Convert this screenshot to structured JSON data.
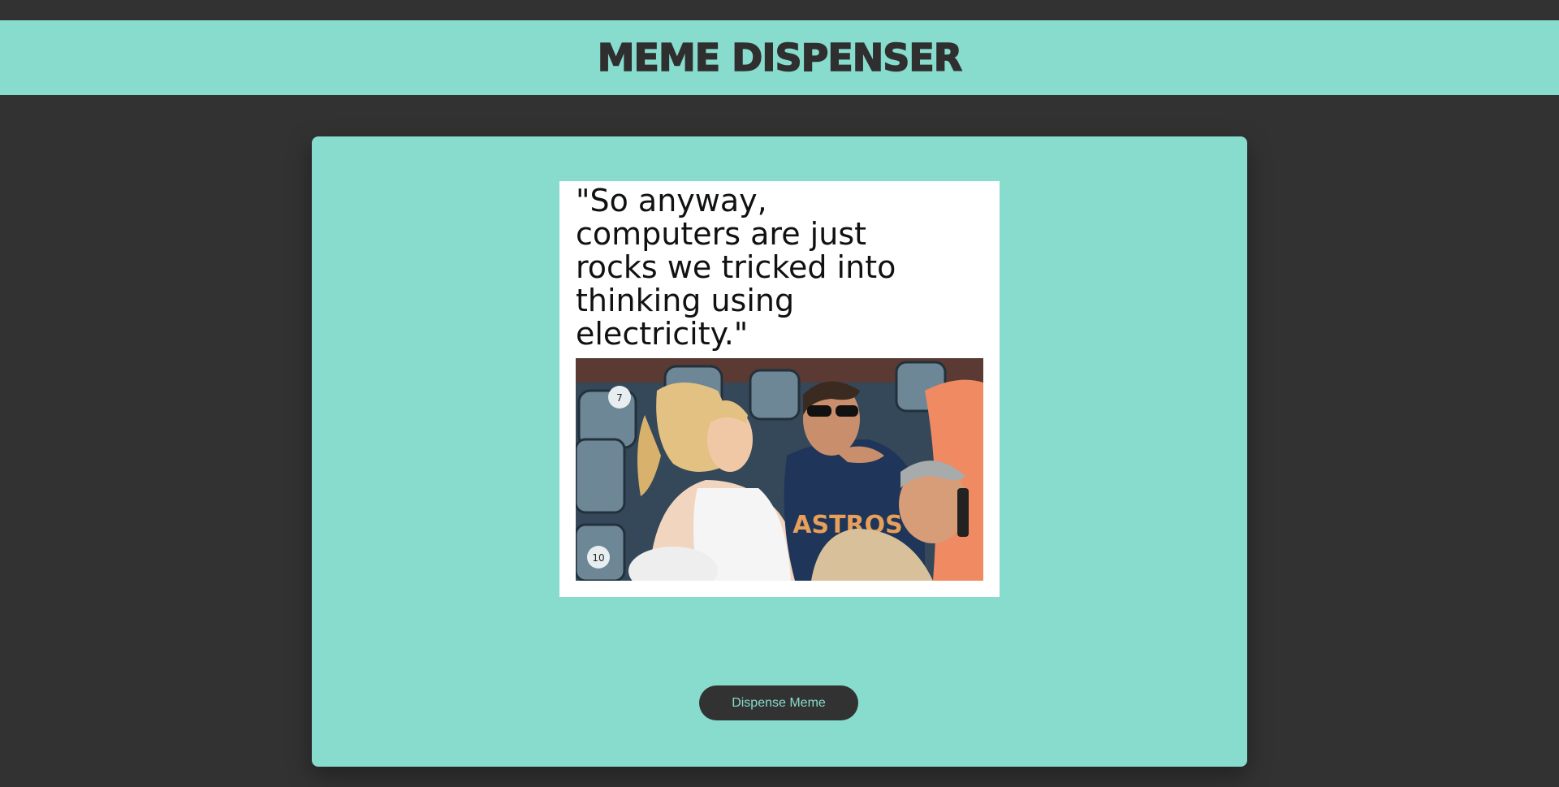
{
  "header": {
    "title": "MEME DISPENSER"
  },
  "meme": {
    "caption": "\"So anyway, computers are just rocks we tricked into thinking using electricity.\"",
    "image": {
      "subject": "meme-photo",
      "shirt_text": "ASTROS",
      "seat_numbers": [
        "7",
        "10"
      ]
    }
  },
  "actions": {
    "dispense_label": "Dispense Meme"
  },
  "colors": {
    "background": "#323232",
    "accent": "#87dccd",
    "card": "#ffffff",
    "text_dark": "#2f2f2f"
  }
}
